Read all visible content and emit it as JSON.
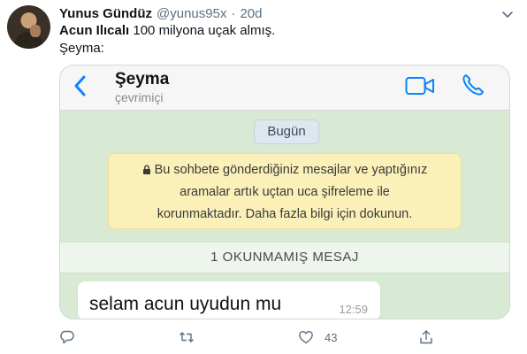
{
  "tweet": {
    "name": "Yunus Gündüz",
    "handle": "@yunus95x",
    "separator": "·",
    "time": "20d",
    "text_bold": "Acun Ilıcalı",
    "text_rest": " 100 milyona uçak almış.",
    "text_line2": "Şeyma:"
  },
  "screenshot": {
    "contact_name": "Şeyma",
    "contact_status": "çevrimiçi",
    "day_label": "Bugün",
    "encryption_lines": [
      "Bu sohbete gönderdiğiniz mesajlar ve yaptığınız",
      "aramalar artık uçtan uca şifreleme ile",
      "korunmaktadır. Daha fazla bilgi için dokunun."
    ],
    "unread_label": "1 OKUNMAMIŞ MESAJ",
    "message_text": "selam acun uyudun mu",
    "message_time": "12:59",
    "accent_color": "#0a84ff"
  },
  "actions": {
    "like_count": "43"
  }
}
